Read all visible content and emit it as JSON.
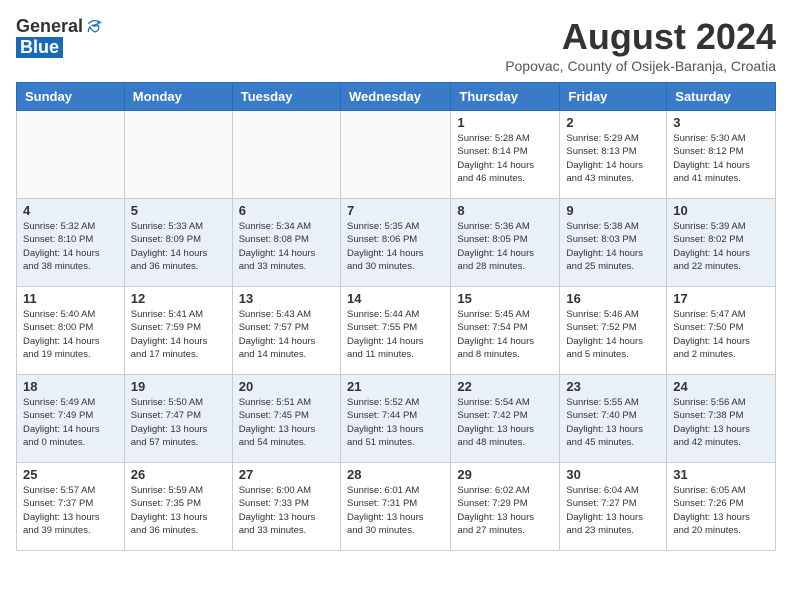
{
  "header": {
    "logo_general": "General",
    "logo_blue": "Blue",
    "month_title": "August 2024",
    "subtitle": "Popovac, County of Osijek-Baranja, Croatia"
  },
  "weekdays": [
    "Sunday",
    "Monday",
    "Tuesday",
    "Wednesday",
    "Thursday",
    "Friday",
    "Saturday"
  ],
  "weeks": [
    [
      {
        "day": "",
        "info": ""
      },
      {
        "day": "",
        "info": ""
      },
      {
        "day": "",
        "info": ""
      },
      {
        "day": "",
        "info": ""
      },
      {
        "day": "1",
        "info": "Sunrise: 5:28 AM\nSunset: 8:14 PM\nDaylight: 14 hours\nand 46 minutes."
      },
      {
        "day": "2",
        "info": "Sunrise: 5:29 AM\nSunset: 8:13 PM\nDaylight: 14 hours\nand 43 minutes."
      },
      {
        "day": "3",
        "info": "Sunrise: 5:30 AM\nSunset: 8:12 PM\nDaylight: 14 hours\nand 41 minutes."
      }
    ],
    [
      {
        "day": "4",
        "info": "Sunrise: 5:32 AM\nSunset: 8:10 PM\nDaylight: 14 hours\nand 38 minutes."
      },
      {
        "day": "5",
        "info": "Sunrise: 5:33 AM\nSunset: 8:09 PM\nDaylight: 14 hours\nand 36 minutes."
      },
      {
        "day": "6",
        "info": "Sunrise: 5:34 AM\nSunset: 8:08 PM\nDaylight: 14 hours\nand 33 minutes."
      },
      {
        "day": "7",
        "info": "Sunrise: 5:35 AM\nSunset: 8:06 PM\nDaylight: 14 hours\nand 30 minutes."
      },
      {
        "day": "8",
        "info": "Sunrise: 5:36 AM\nSunset: 8:05 PM\nDaylight: 14 hours\nand 28 minutes."
      },
      {
        "day": "9",
        "info": "Sunrise: 5:38 AM\nSunset: 8:03 PM\nDaylight: 14 hours\nand 25 minutes."
      },
      {
        "day": "10",
        "info": "Sunrise: 5:39 AM\nSunset: 8:02 PM\nDaylight: 14 hours\nand 22 minutes."
      }
    ],
    [
      {
        "day": "11",
        "info": "Sunrise: 5:40 AM\nSunset: 8:00 PM\nDaylight: 14 hours\nand 19 minutes."
      },
      {
        "day": "12",
        "info": "Sunrise: 5:41 AM\nSunset: 7:59 PM\nDaylight: 14 hours\nand 17 minutes."
      },
      {
        "day": "13",
        "info": "Sunrise: 5:43 AM\nSunset: 7:57 PM\nDaylight: 14 hours\nand 14 minutes."
      },
      {
        "day": "14",
        "info": "Sunrise: 5:44 AM\nSunset: 7:55 PM\nDaylight: 14 hours\nand 11 minutes."
      },
      {
        "day": "15",
        "info": "Sunrise: 5:45 AM\nSunset: 7:54 PM\nDaylight: 14 hours\nand 8 minutes."
      },
      {
        "day": "16",
        "info": "Sunrise: 5:46 AM\nSunset: 7:52 PM\nDaylight: 14 hours\nand 5 minutes."
      },
      {
        "day": "17",
        "info": "Sunrise: 5:47 AM\nSunset: 7:50 PM\nDaylight: 14 hours\nand 2 minutes."
      }
    ],
    [
      {
        "day": "18",
        "info": "Sunrise: 5:49 AM\nSunset: 7:49 PM\nDaylight: 14 hours\nand 0 minutes."
      },
      {
        "day": "19",
        "info": "Sunrise: 5:50 AM\nSunset: 7:47 PM\nDaylight: 13 hours\nand 57 minutes."
      },
      {
        "day": "20",
        "info": "Sunrise: 5:51 AM\nSunset: 7:45 PM\nDaylight: 13 hours\nand 54 minutes."
      },
      {
        "day": "21",
        "info": "Sunrise: 5:52 AM\nSunset: 7:44 PM\nDaylight: 13 hours\nand 51 minutes."
      },
      {
        "day": "22",
        "info": "Sunrise: 5:54 AM\nSunset: 7:42 PM\nDaylight: 13 hours\nand 48 minutes."
      },
      {
        "day": "23",
        "info": "Sunrise: 5:55 AM\nSunset: 7:40 PM\nDaylight: 13 hours\nand 45 minutes."
      },
      {
        "day": "24",
        "info": "Sunrise: 5:56 AM\nSunset: 7:38 PM\nDaylight: 13 hours\nand 42 minutes."
      }
    ],
    [
      {
        "day": "25",
        "info": "Sunrise: 5:57 AM\nSunset: 7:37 PM\nDaylight: 13 hours\nand 39 minutes."
      },
      {
        "day": "26",
        "info": "Sunrise: 5:59 AM\nSunset: 7:35 PM\nDaylight: 13 hours\nand 36 minutes."
      },
      {
        "day": "27",
        "info": "Sunrise: 6:00 AM\nSunset: 7:33 PM\nDaylight: 13 hours\nand 33 minutes."
      },
      {
        "day": "28",
        "info": "Sunrise: 6:01 AM\nSunset: 7:31 PM\nDaylight: 13 hours\nand 30 minutes."
      },
      {
        "day": "29",
        "info": "Sunrise: 6:02 AM\nSunset: 7:29 PM\nDaylight: 13 hours\nand 27 minutes."
      },
      {
        "day": "30",
        "info": "Sunrise: 6:04 AM\nSunset: 7:27 PM\nDaylight: 13 hours\nand 23 minutes."
      },
      {
        "day": "31",
        "info": "Sunrise: 6:05 AM\nSunset: 7:26 PM\nDaylight: 13 hours\nand 20 minutes."
      }
    ]
  ]
}
